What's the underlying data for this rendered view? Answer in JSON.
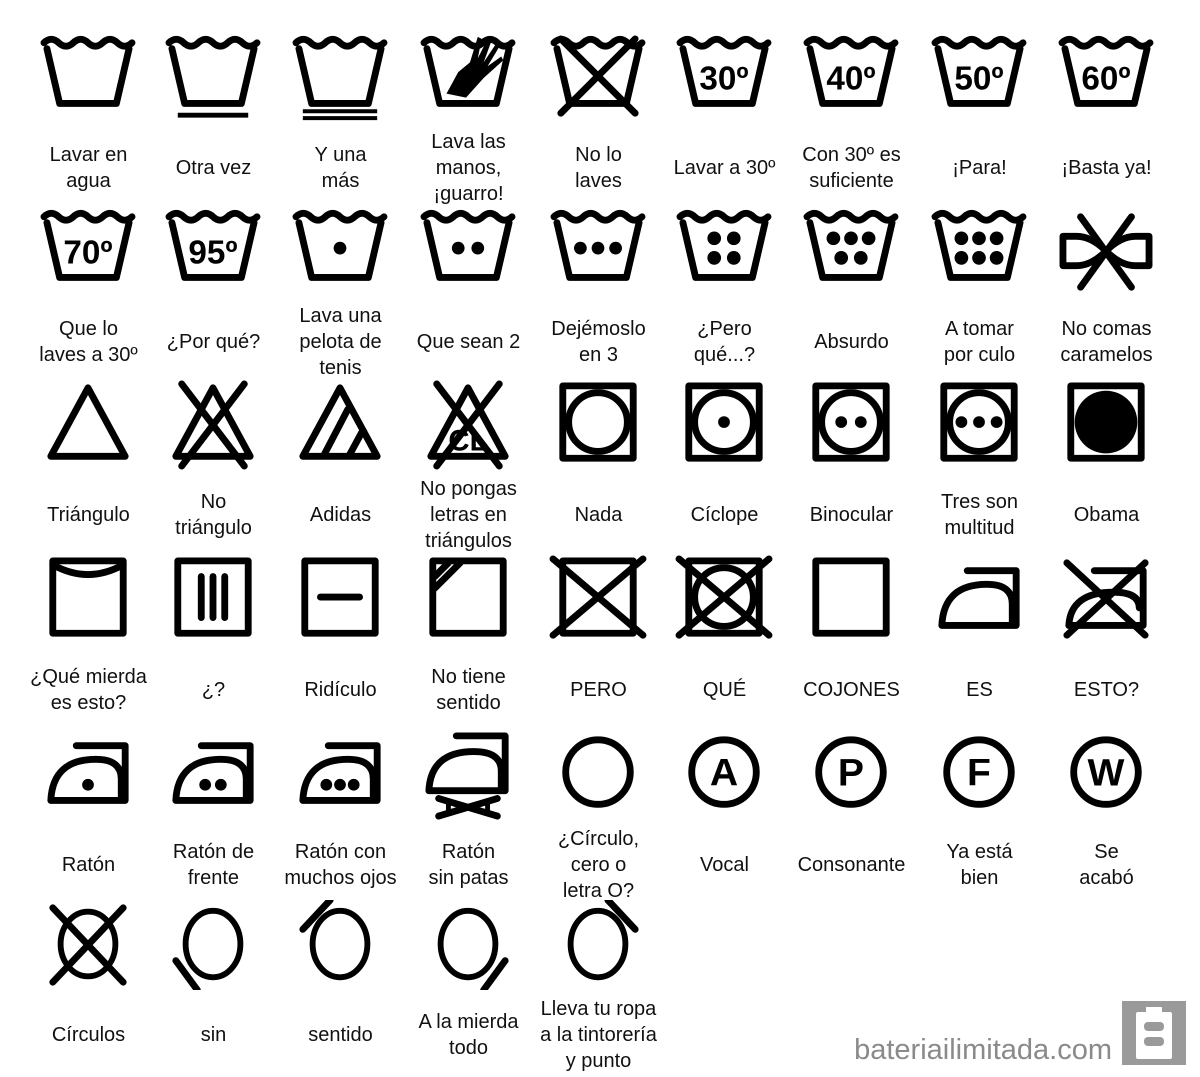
{
  "colors": {
    "ink": "#000000",
    "watermark": "#8a8a8a"
  },
  "rows": [
    [
      {
        "icon": "wash-tub-icon",
        "label": "Lavar en\nagua"
      },
      {
        "icon": "wash-tub-one-bar-icon",
        "bars": 1,
        "label": "Otra vez"
      },
      {
        "icon": "wash-tub-two-bars-icon",
        "bars": 2,
        "label": "Y una\nmás"
      },
      {
        "icon": "hand-wash-icon",
        "label": "Lava las\nmanos,\n¡guarro!"
      },
      {
        "icon": "do-not-wash-icon",
        "label": "No lo\nlaves"
      },
      {
        "icon": "wash-temperature-icon",
        "mark": "30º",
        "label": "Lavar a 30º"
      },
      {
        "icon": "wash-temperature-icon",
        "mark": "40º",
        "label": "Con 30º es\nsuficiente"
      },
      {
        "icon": "wash-temperature-icon",
        "mark": "50º",
        "label": "¡Para!"
      },
      {
        "icon": "wash-temperature-icon",
        "mark": "60º",
        "label": "¡Basta ya!"
      }
    ],
    [
      {
        "icon": "wash-temperature-icon",
        "mark": "70º",
        "label": "Que lo\nlaves a 30º"
      },
      {
        "icon": "wash-temperature-icon",
        "mark": "95º",
        "label": "¿Por qué?"
      },
      {
        "icon": "wash-dots-icon",
        "dots": 1,
        "label": "Lava una\npelota de\ntenis"
      },
      {
        "icon": "wash-dots-icon",
        "dots": 2,
        "label": "Que sean 2"
      },
      {
        "icon": "wash-dots-icon",
        "dots": 3,
        "label": "Dejémoslo\nen 3"
      },
      {
        "icon": "wash-dots-icon",
        "dots": 4,
        "label": "¿Pero\nqué...?"
      },
      {
        "icon": "wash-dots-icon",
        "dots": 5,
        "label": "Absurdo"
      },
      {
        "icon": "wash-dots-icon",
        "dots": 6,
        "label": "A tomar\npor culo"
      },
      {
        "icon": "do-not-wring-icon",
        "label": "No comas\ncaramelos"
      }
    ],
    [
      {
        "icon": "bleach-triangle-icon",
        "label": "Triángulo"
      },
      {
        "icon": "no-bleach-icon",
        "label": "No\ntriángulo"
      },
      {
        "icon": "non-chlorine-bleach-icon",
        "label": "Adidas"
      },
      {
        "icon": "no-chlorine-bleach-icon",
        "mark": "CL",
        "label": "No pongas\nletras en\ntriángulos"
      },
      {
        "icon": "tumble-dry-icon",
        "dots": 0,
        "label": "Nada"
      },
      {
        "icon": "tumble-dry-icon",
        "dots": 1,
        "label": "Cíclope"
      },
      {
        "icon": "tumble-dry-icon",
        "dots": 2,
        "label": "Binocular"
      },
      {
        "icon": "tumble-dry-icon",
        "dots": 3,
        "label": "Tres son\nmultitud"
      },
      {
        "icon": "tumble-dry-filled-icon",
        "label": "Obama"
      }
    ],
    [
      {
        "icon": "line-dry-icon",
        "label": "¿Qué mierda\nes esto?"
      },
      {
        "icon": "drip-dry-icon",
        "label": "¿?"
      },
      {
        "icon": "dry-flat-icon",
        "label": "Ridículo"
      },
      {
        "icon": "dry-in-shade-icon",
        "label": "No tiene\nsentido"
      },
      {
        "icon": "do-not-dry-icon",
        "label": "PERO"
      },
      {
        "icon": "do-not-tumble-dry-icon",
        "label": "QUÉ"
      },
      {
        "icon": "natural-dry-icon",
        "label": "COJONES"
      },
      {
        "icon": "iron-icon",
        "label": "ES"
      },
      {
        "icon": "do-not-iron-icon",
        "label": "ESTO?"
      }
    ],
    [
      {
        "icon": "iron-dots-icon",
        "dots": 1,
        "label": "Ratón"
      },
      {
        "icon": "iron-dots-icon",
        "dots": 2,
        "label": "Ratón de\nfrente"
      },
      {
        "icon": "iron-dots-icon",
        "dots": 3,
        "label": "Ratón con\nmuchos ojos"
      },
      {
        "icon": "no-steam-iron-icon",
        "label": "Ratón\nsin patas"
      },
      {
        "icon": "dry-clean-icon",
        "label": "¿Círculo,\ncero o\nletra O?"
      },
      {
        "icon": "dry-clean-letter-icon",
        "mark": "A",
        "label": "Vocal"
      },
      {
        "icon": "dry-clean-letter-icon",
        "mark": "P",
        "label": "Consonante"
      },
      {
        "icon": "dry-clean-letter-icon",
        "mark": "F",
        "label": "Ya está\nbien"
      },
      {
        "icon": "dry-clean-letter-icon",
        "mark": "W",
        "label": "Se\nacabó"
      }
    ],
    [
      {
        "icon": "do-not-dry-clean-icon",
        "label": "Círculos"
      },
      {
        "icon": "circle-bar-icon",
        "corner": "bottom-left",
        "label": "sin"
      },
      {
        "icon": "circle-bar-icon",
        "corner": "top-left",
        "label": "sentido"
      },
      {
        "icon": "circle-bar-icon",
        "corner": "bottom-right",
        "label": "A la mierda\ntodo"
      },
      {
        "icon": "circle-bar-icon",
        "corner": "top-right",
        "label": "Lleva tu ropa\na la tintorería\ny punto"
      }
    ]
  ],
  "watermark": {
    "text": "bateriailimitada.com",
    "logo_icon": "battery-logo-icon"
  }
}
